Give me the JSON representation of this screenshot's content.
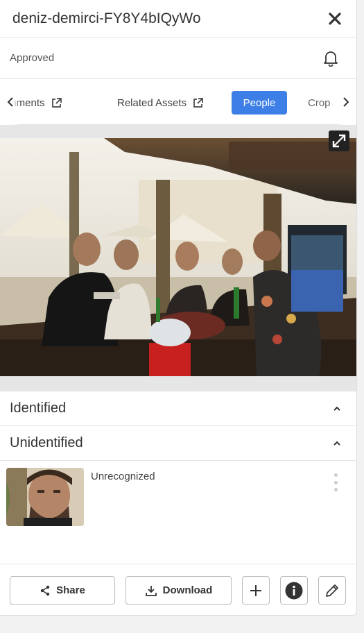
{
  "header": {
    "title": "deniz-demirci-FY8Y4bIQyWo",
    "close_icon": "close-icon"
  },
  "status": {
    "label": "Approved",
    "bell_icon": "bell-icon"
  },
  "tabs": {
    "items": [
      {
        "label": "Comments",
        "external": true
      },
      {
        "label": "Related Assets",
        "external": true
      },
      {
        "label": "People",
        "active": true
      },
      {
        "label": "Crop"
      }
    ],
    "left_icon": "chevron-left-icon",
    "right_icon": "chevron-right-icon"
  },
  "image": {
    "expand_icon": "expand-icon"
  },
  "sections": {
    "identified": {
      "label": "Identified",
      "icon": "chevron-up-icon"
    },
    "unidentified": {
      "label": "Unidentified",
      "icon": "chevron-up-icon"
    }
  },
  "faces": [
    {
      "label": "Unrecognized"
    }
  ],
  "footer": {
    "share_label": "Share",
    "download_label": "Download",
    "add_icon": "plus-icon",
    "info_icon": "info-icon",
    "edit_icon": "pencil-icon"
  },
  "colors": {
    "accent": "#3d7fe6",
    "border": "#e3e3e3",
    "text": "#333333"
  }
}
